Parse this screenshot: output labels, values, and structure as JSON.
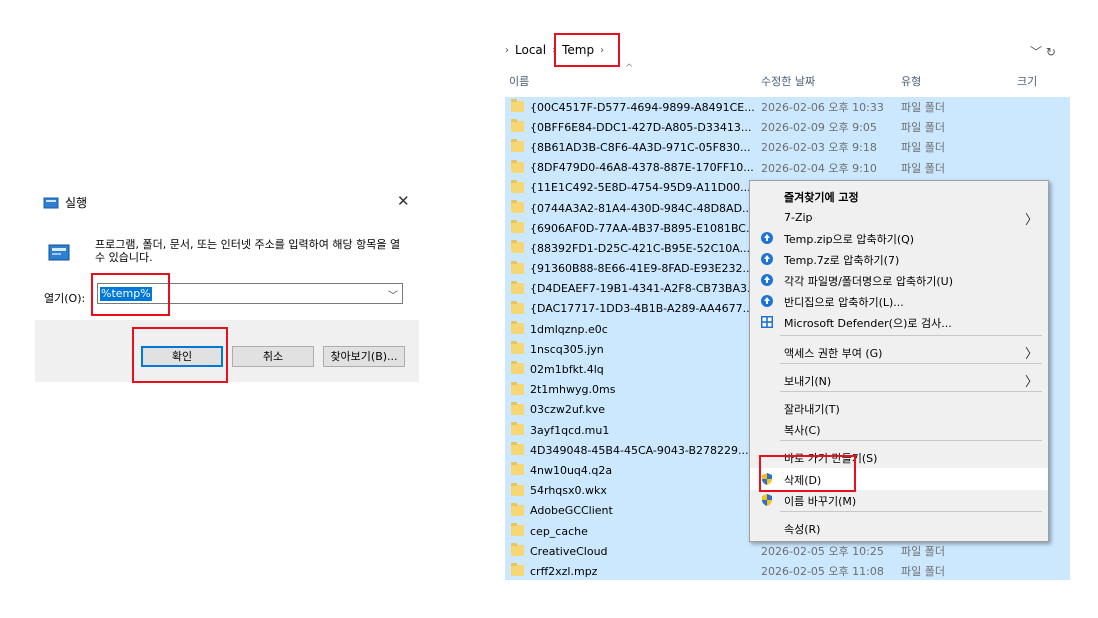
{
  "run_dialog": {
    "title": "실행",
    "close": "✕",
    "description": "프로그램, 폴더, 문서, 또는 인터넷 주소를 입력하여 해당 항목을 열 수 있습니다.",
    "open_label": "열기(O):",
    "open_value": "%temp%",
    "buttons": {
      "ok": "확인",
      "cancel": "취소",
      "browse": "찾아보기(B)..."
    }
  },
  "explorer": {
    "breadcrumb": [
      "Local",
      "Temp"
    ],
    "columns": {
      "name": "이름",
      "date": "수정한 날짜",
      "type": "유형",
      "size": "크기"
    },
    "files": [
      {
        "name": "{00C4517F-D577-4694-9899-A8491CE...",
        "date": "2026-02-06 오후 10:33",
        "type": "파일 폴더"
      },
      {
        "name": "{0BFF6E84-DDC1-427D-A805-D33413...",
        "date": "2026-02-09 오후 9:05",
        "type": "파일 폴더"
      },
      {
        "name": "{8B61AD3B-C8F6-4A3D-971C-05F830...",
        "date": "2026-02-03 오후 9:18",
        "type": "파일 폴더"
      },
      {
        "name": "{8DF479D0-46A8-4378-887E-170FF10...",
        "date": "2026-02-04 오후 9:10",
        "type": "파일 폴더"
      },
      {
        "name": "{11E1C492-5E8D-4754-95D9-A11D00...",
        "date": "",
        "type": ""
      },
      {
        "name": "{0744A3A2-81A4-430D-984C-48D8AD...",
        "date": "",
        "type": ""
      },
      {
        "name": "{6906AF0D-77AA-4B37-B895-E1081BC...",
        "date": "",
        "type": ""
      },
      {
        "name": "{88392FD1-D25C-421C-B95E-52C10A...",
        "date": "",
        "type": ""
      },
      {
        "name": "{91360B88-8E66-41E9-8FAD-E93E232...",
        "date": "",
        "type": ""
      },
      {
        "name": "{D4DEAEF7-19B1-4341-A2F8-CB73BA3...",
        "date": "",
        "type": ""
      },
      {
        "name": "{DAC17717-1DD3-4B1B-A289-AA4677...",
        "date": "",
        "type": ""
      },
      {
        "name": "1dmlqznp.e0c",
        "date": "",
        "type": ""
      },
      {
        "name": "1nscq305.jyn",
        "date": "",
        "type": ""
      },
      {
        "name": "02m1bfkt.4lq",
        "date": "",
        "type": ""
      },
      {
        "name": "2t1mhwyg.0ms",
        "date": "",
        "type": ""
      },
      {
        "name": "03czw2uf.kve",
        "date": "",
        "type": ""
      },
      {
        "name": "3ayf1qcd.mu1",
        "date": "",
        "type": ""
      },
      {
        "name": "4D349048-45B4-45CA-9043-B278229...",
        "date": "",
        "type": ""
      },
      {
        "name": "4nw10uq4.q2a",
        "date": "",
        "type": ""
      },
      {
        "name": "54rhqsx0.wkx",
        "date": "",
        "type": ""
      },
      {
        "name": "AdobeGCClient",
        "date": "",
        "type": ""
      },
      {
        "name": "cep_cache",
        "date": "",
        "type": ""
      },
      {
        "name": "CreativeCloud",
        "date": "2026-02-05 오후 10:25",
        "type": "파일 폴더"
      },
      {
        "name": "crff2xzl.mpz",
        "date": "2026-02-05 오후 11:08",
        "type": "파일 폴더"
      }
    ]
  },
  "context_menu": {
    "items": [
      {
        "label": "즐겨찾기에 고정",
        "bold": true
      },
      {
        "label": "7-Zip",
        "submenu": true
      },
      {
        "label": "Temp.zip으로 압축하기(Q)",
        "icon": "bandizip-icon"
      },
      {
        "label": "Temp.7z로 압축하기(7)",
        "icon": "bandizip-icon"
      },
      {
        "label": "각각 파일명/폴더명으로 압축하기(U)",
        "icon": "bandizip-icon"
      },
      {
        "label": "반디집으로 압축하기(L)...",
        "icon": "bandizip-icon"
      },
      {
        "label": "Microsoft Defender(으)로 검사...",
        "icon": "defender-icon"
      },
      {
        "label": "액세스 권한 부여 (G)",
        "submenu": true
      },
      {
        "label": "보내기(N)",
        "submenu": true
      },
      {
        "label": "잘라내기(T)"
      },
      {
        "label": "복사(C)"
      },
      {
        "label": "바로 가기 만들기(S)"
      },
      {
        "label": "삭제(D)",
        "icon": "shield-icon"
      },
      {
        "label": "이름 바꾸기(M)",
        "icon": "shield-icon"
      },
      {
        "label": "속성(R)"
      }
    ]
  },
  "colors": {
    "selection": "#cce8ff",
    "highlight_box": "#e8101d",
    "accent": "#0078d7"
  }
}
